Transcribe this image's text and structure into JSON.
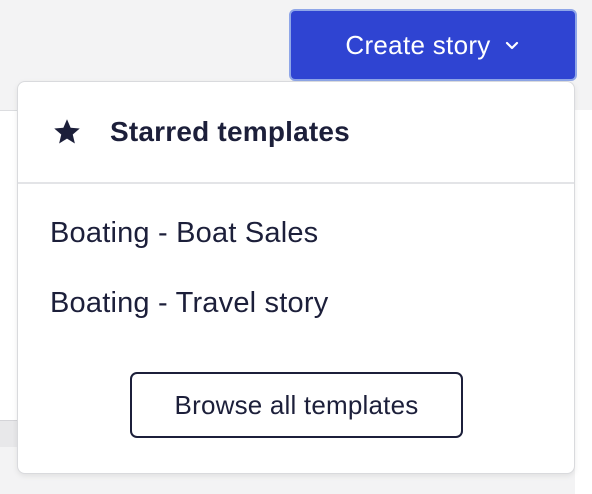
{
  "header": {
    "create_button_label": "Create story"
  },
  "dropdown": {
    "title": "Starred templates",
    "items": [
      {
        "label": "Boating - Boat Sales"
      },
      {
        "label": "Boating - Travel story"
      }
    ],
    "browse_label": "Browse all templates"
  },
  "icons": {
    "create_chevron": "chevron-down-icon",
    "header_star": "star-icon"
  },
  "colors": {
    "primary": "#2f44d2",
    "primary_border": "#8fa6e8",
    "text_dark": "#1c1f3a",
    "divider": "#e3e4e7"
  }
}
